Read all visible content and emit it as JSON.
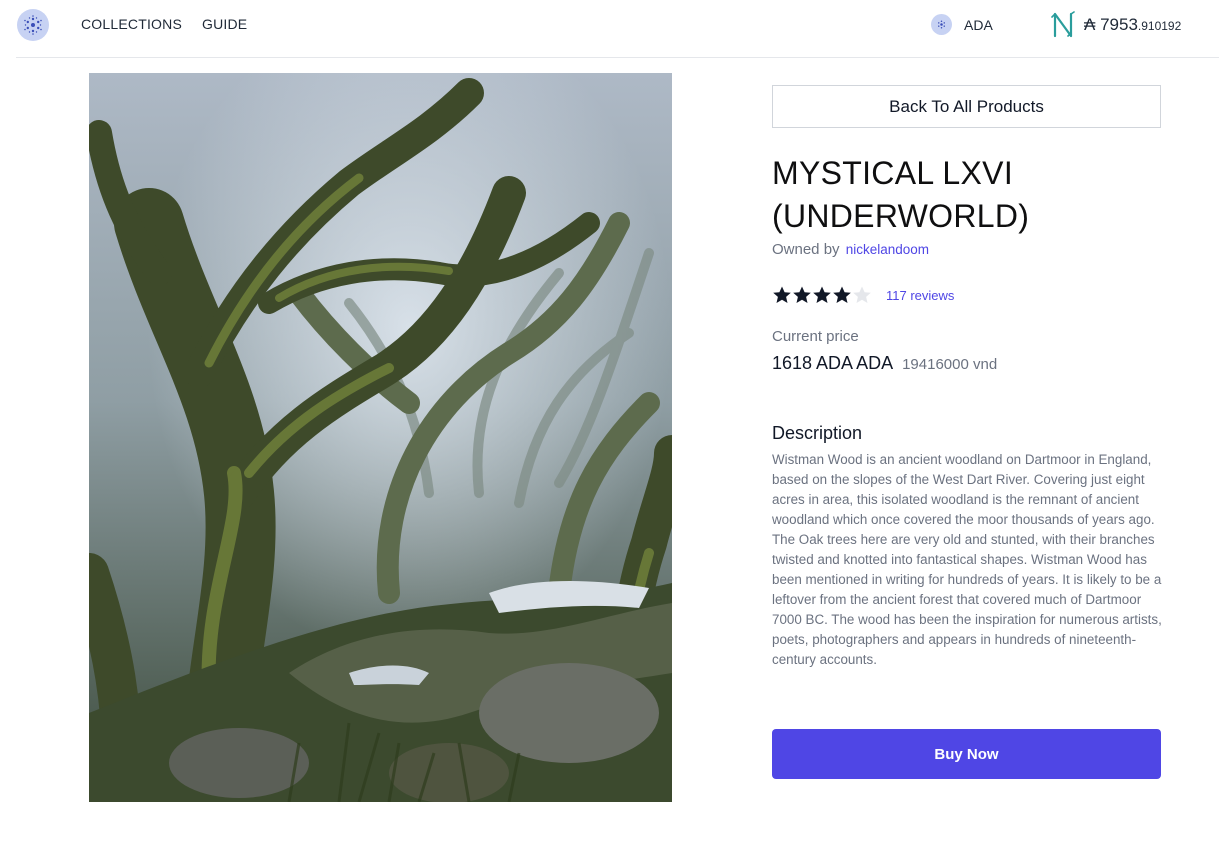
{
  "header": {
    "nav": {
      "collections": "COLLECTIONS",
      "guide": "GUIDE"
    },
    "network_label": "ADA",
    "wallet": {
      "symbol": "₳",
      "balance_main": "7953",
      "balance_fraction": ".910192"
    }
  },
  "product": {
    "back_label": "Back To All Products",
    "title": "MYSTICAL LXVI (UNDERWORLD)",
    "owned_prefix": "Owned by",
    "owner": "nickelandoom",
    "rating": {
      "value": 4,
      "max": 5
    },
    "reviews": "117 reviews",
    "price_label": "Current price",
    "price": "1618 ADA ADA",
    "price_vnd": "19416000 vnd",
    "description_heading": "Description",
    "description": "Wistman Wood is an ancient woodland on Dartmoor in England, based on the slopes of the West Dart River. Covering just eight acres in area, this isolated woodland is the remnant of ancient woodland which once covered the moor thousands of years ago. The Oak trees here are very old and stunted, with their branches twisted and knotted into fantastical shapes. Wistman Wood has been mentioned in writing for hundreds of years. It is likely to be a leftover from the ancient forest that covered much of Dartmoor 7000 BC. The wood has been the inspiration for numerous artists, poets, photographers and appears in hundreds of nineteenth-century accounts.",
    "buy_label": "Buy Now"
  },
  "colors": {
    "accent": "#4f46e5",
    "star_filled": "#111827",
    "star_empty": "#e5e7eb"
  },
  "icons": {
    "logo": "cardano-logo-icon",
    "network": "cardano-icon",
    "wallet": "nami-wallet-icon",
    "rating": "star-icon"
  }
}
